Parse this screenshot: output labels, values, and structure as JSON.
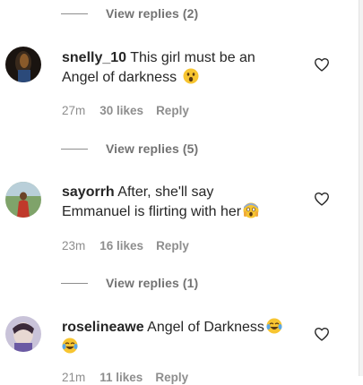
{
  "threads": [
    {
      "replies_label": "View replies (2)"
    },
    {
      "replies_label": "View replies (5)"
    },
    {
      "replies_label": "View replies (1)"
    }
  ],
  "comments": [
    {
      "username": "snelly_10",
      "line1": "This girl must be an",
      "line2": "Angel of darkness",
      "emoji": "astonished-face",
      "time": "27m",
      "likes": "30 likes",
      "reply": "Reply"
    },
    {
      "username": "sayorrh",
      "line1": "After, she'll say",
      "line2": "Emmanuel is flirting with her",
      "emoji": "face-screaming-in-fear",
      "time": "23m",
      "likes": "16 likes",
      "reply": "Reply"
    },
    {
      "username": "roselineawe",
      "line1": "Angel of Darkness",
      "emoji": "face-with-tears-of-joy",
      "time": "21m",
      "likes": "11 likes",
      "reply": "Reply"
    }
  ],
  "icons": {
    "heart": "heart-outline-icon"
  },
  "colors": {
    "text": "#262626",
    "secondary": "#8e8e8e",
    "replies": "#737373"
  }
}
